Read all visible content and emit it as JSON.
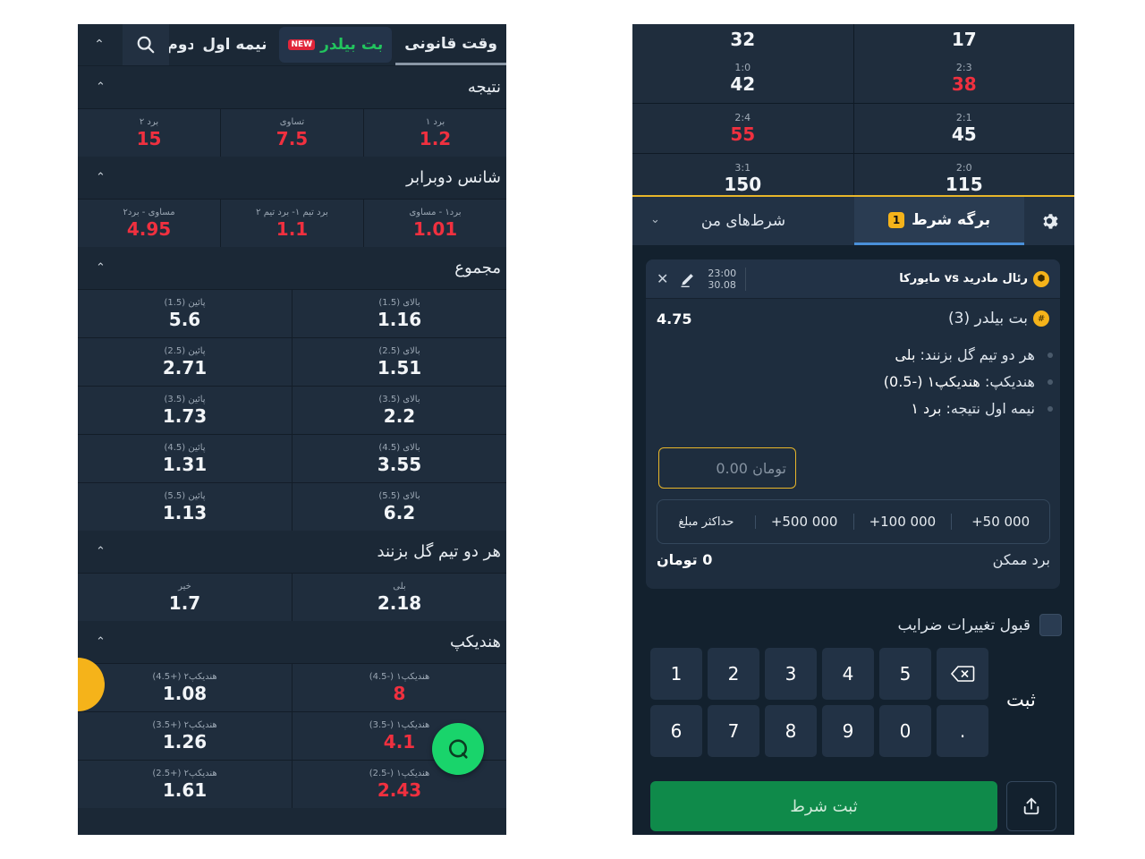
{
  "left": {
    "tabs": {
      "regular": "وقت قانونی",
      "builder_label": "بت بیلدر",
      "builder_badge": "NEW",
      "first_half": "نیمه اول",
      "cut_tab": "نیمه دوم"
    },
    "markets": {
      "result": {
        "title": "نتیجه",
        "cells": [
          {
            "label": "برد ۱",
            "odd": "1.2",
            "red": true
          },
          {
            "label": "تساوی",
            "odd": "7.5",
            "red": true
          },
          {
            "label": "برد ۲",
            "odd": "15",
            "red": true
          }
        ]
      },
      "double_chance": {
        "title": "شانس دوبرابر",
        "cells": [
          {
            "label": "برد۱ - مساوی",
            "odd": "1.01",
            "red": true
          },
          {
            "label": "برد تیم ۱- برد تیم ۲",
            "odd": "1.1",
            "red": true
          },
          {
            "label": "مساوی - برد۲",
            "odd": "4.95",
            "red": true
          }
        ]
      },
      "total": {
        "title": "مجموع",
        "rows": [
          [
            {
              "label": "بالای (1.5)",
              "odd": "1.16"
            },
            {
              "label": "پائین (1.5)",
              "odd": "5.6"
            }
          ],
          [
            {
              "label": "بالای (2.5)",
              "odd": "1.51"
            },
            {
              "label": "پائین (2.5)",
              "odd": "2.71"
            }
          ],
          [
            {
              "label": "بالای (3.5)",
              "odd": "2.2"
            },
            {
              "label": "پائین (3.5)",
              "odd": "1.73"
            }
          ],
          [
            {
              "label": "بالای (4.5)",
              "odd": "3.55"
            },
            {
              "label": "پائین (4.5)",
              "odd": "1.31"
            }
          ],
          [
            {
              "label": "بالای (5.5)",
              "odd": "6.2"
            },
            {
              "label": "پائین (5.5)",
              "odd": "1.13"
            }
          ]
        ]
      },
      "btts": {
        "title": "هر دو تیم گل بزنند",
        "cells": [
          {
            "label": "بلی",
            "odd": "2.18"
          },
          {
            "label": "خیر",
            "odd": "1.7"
          }
        ]
      },
      "handicap": {
        "title": "هندیکپ",
        "rows": [
          [
            {
              "label": "هندیکپ۱ (-4.5)",
              "odd": "8",
              "red": true
            },
            {
              "label": "هندیکپ۲ (+4.5)",
              "odd": "1.08"
            }
          ],
          [
            {
              "label": "هندیکپ۱ (-3.5)",
              "odd": "4.1",
              "red": true
            },
            {
              "label": "هندیکپ۲ (+3.5)",
              "odd": "1.26"
            }
          ],
          [
            {
              "label": "هندیکپ۱ (-2.5)",
              "odd": "2.43",
              "red": true
            },
            {
              "label": "هندیکپ۲ (+2.5)",
              "odd": "1.61"
            }
          ]
        ]
      }
    }
  },
  "right": {
    "score_grid": [
      [
        {
          "score": "",
          "odd": "32"
        },
        {
          "score": "",
          "odd": "17"
        }
      ],
      [
        {
          "score": "1:0",
          "odd": "42"
        },
        {
          "score": "2:3",
          "odd": "38",
          "red": true
        }
      ],
      [
        {
          "score": "2:4",
          "odd": "55",
          "red": true
        },
        {
          "score": "2:1",
          "odd": "45"
        }
      ],
      [
        {
          "score": "3:1",
          "odd": "150"
        },
        {
          "score": "2:0",
          "odd": "115"
        }
      ]
    ],
    "slip_tabs": {
      "slip": "برگه شرط",
      "slip_count": "1",
      "my_bets": "شرط‌های من"
    },
    "match": {
      "teams": "رئال مادرید vs مایورکا",
      "time": "23:00",
      "date": "30.08"
    },
    "builder": {
      "title": "بت بیلدر (3)",
      "odd": "4.75",
      "selections": [
        {
          "market": "هر دو تیم گل بزنند:",
          "pick": "بلی"
        },
        {
          "market": "هندیکپ:",
          "pick": "هندیکپ۱ (-0.5)"
        },
        {
          "market": "نیمه اول نتیجه:",
          "pick": "برد ۱"
        }
      ]
    },
    "amount_placeholder": "0.00 تومان",
    "quick_amounts": [
      "+50 000",
      "+100 000",
      "+500 000",
      "حداکثر مبلغ"
    ],
    "possible_win_label": "برد ممکن",
    "possible_win_value": "0 تومان",
    "accept_changes": "قبول تغییرات ضرایب",
    "keys": [
      "1",
      "2",
      "3",
      "4",
      "5",
      "⌫",
      "6",
      "7",
      "8",
      "9",
      "0",
      "."
    ],
    "submit_label": "ثبت",
    "place_bet": "ثبت شرط"
  },
  "colors": {
    "panel": "#1b2836",
    "cell": "#1f2d3d",
    "red": "#f0303f",
    "accent_green": "#22c55e",
    "accent_yellow": "#f5b31a"
  }
}
